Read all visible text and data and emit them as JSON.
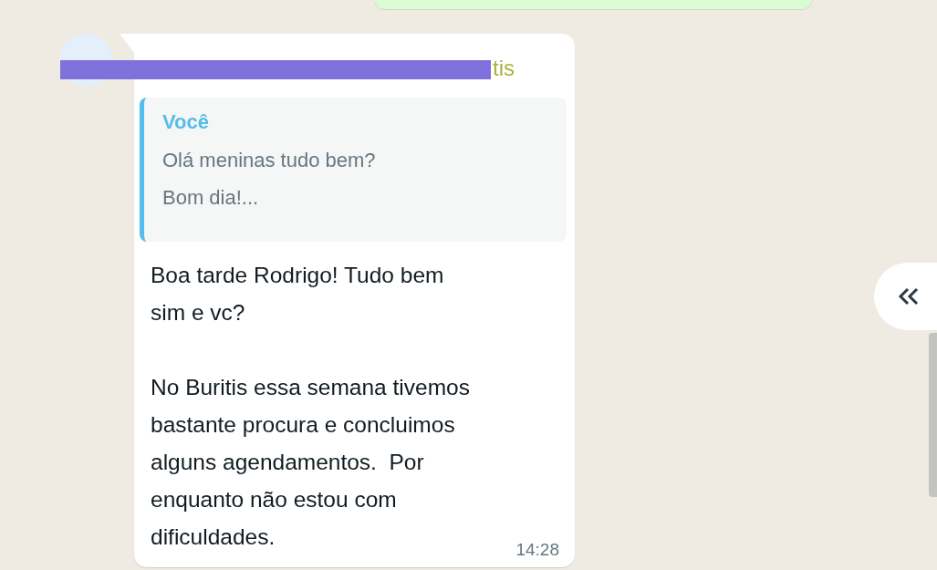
{
  "message": {
    "sender_visible": "tis",
    "quote": {
      "author": "Você",
      "text": "Olá meninas tudo bem?\nBom dia!..."
    },
    "text": "Boa tarde Rodrigo! Tudo bem\nsim e vc?\n\nNo Buritis essa semana tivemos\nbastante procura e concluimos\nalguns agendamentos.  Por\nenquanto não estou com\ndificuldades.",
    "time": "14:28"
  }
}
